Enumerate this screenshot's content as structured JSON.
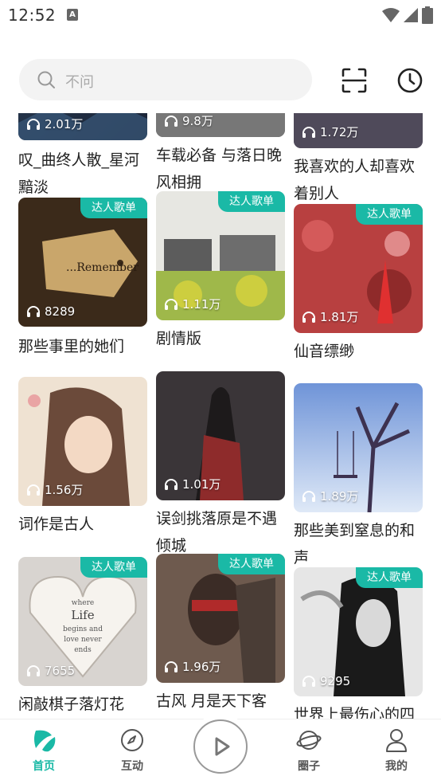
{
  "status_bar": {
    "time": "12:52",
    "notification_glyph": "A"
  },
  "search": {
    "placeholder": "不问"
  },
  "feed": {
    "badge_label": "达人歌单",
    "rows": [
      [
        {
          "plays": "2.01万",
          "title": "叹_曲终人散_星河黯淡",
          "badge": false
        },
        {
          "plays": "9.8万",
          "title": "车载必备 与落日晚风相拥",
          "badge": false
        },
        {
          "plays": "1.72万",
          "title": "我喜欢的人却喜欢着别人",
          "badge": false
        }
      ],
      [
        {
          "plays": "8289",
          "title": "那些事里的她们",
          "badge": true,
          "cover_text": "Remember"
        },
        {
          "plays": "1.11万",
          "title": "剧情版",
          "badge": true
        },
        {
          "plays": "1.81万",
          "title": "仙音缥缈",
          "badge": true
        }
      ],
      [
        {
          "plays": "1.56万",
          "title": "词作是古人",
          "badge": false
        },
        {
          "plays": "1.01万",
          "title": "误剑挑落原是不遇倾城",
          "badge": false
        },
        {
          "plays": "1.89万",
          "title": "那些美到窒息的和声",
          "badge": false
        }
      ],
      [
        {
          "plays": "7655",
          "title": "闲敲棋子落灯花",
          "badge": true,
          "cover_text": "where\nLife\nbegins and\nlove never\nends"
        },
        {
          "plays": "1.96万",
          "title": "古风 月是天下客",
          "badge": true
        },
        {
          "plays": "9295",
          "title": "世界上最伤心的四",
          "badge": true
        }
      ]
    ]
  },
  "nav": {
    "home": "首页",
    "interact": "互动",
    "circle": "圈子",
    "mine": "我的"
  },
  "colors": {
    "accent": "#1ab9a6",
    "search_bg": "#f3f3f3"
  }
}
